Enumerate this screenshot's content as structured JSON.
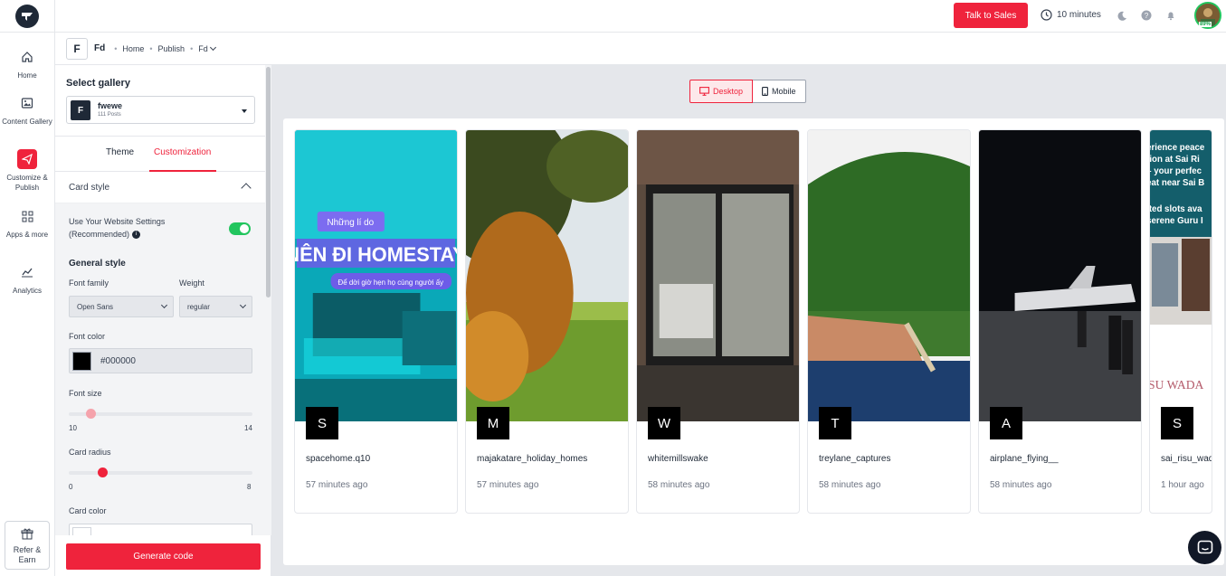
{
  "topbar": {
    "talk_label": "Talk to Sales",
    "timer_label": "10 minutes",
    "avatar_percent": "89%"
  },
  "rail": {
    "items": [
      {
        "label": "Home",
        "icon": "home-icon"
      },
      {
        "label": "Content Gallery",
        "icon": "image-icon"
      },
      {
        "label": "Customize & Publish",
        "icon": "send-icon"
      },
      {
        "label": "Apps & more",
        "icon": "grid-icon"
      },
      {
        "label": "Analytics",
        "icon": "chart-icon"
      }
    ],
    "refer_label": "Refer & Earn"
  },
  "breadcrumb": {
    "badge": "F",
    "name": "Fd",
    "items": [
      "Home",
      "Publish",
      "Fd"
    ]
  },
  "panel": {
    "select_gallery_title": "Select gallery",
    "gallery": {
      "badge": "F",
      "name": "fwewe",
      "posts": "111 Posts"
    },
    "tabs": [
      "Theme",
      "Customization"
    ],
    "active_tab": "Customization",
    "card_style_title": "Card style",
    "website_settings_label": "Use Your Website Settings (Recommended)",
    "website_settings_on": true,
    "general_style_title": "General style",
    "font_family_label": "Font family",
    "font_family_value": "Open Sans",
    "weight_label": "Weight",
    "weight_value": "regular",
    "font_color_label": "Font color",
    "font_color_value": "#000000",
    "font_size_label": "Font size",
    "font_size_min": "10",
    "font_size_max": "14",
    "font_size_level": 0.12,
    "card_radius_label": "Card radius",
    "card_radius_min": "0",
    "card_radius_max": "8",
    "card_radius_level": 0.18,
    "card_color_label": "Card color",
    "generate_label": "Generate code"
  },
  "preview": {
    "desktop_label": "Desktop",
    "mobile_label": "Mobile",
    "active_device": "Desktop",
    "cards": [
      {
        "initial": "S",
        "user": "spacehome.q10",
        "time": "57 minutes ago"
      },
      {
        "initial": "M",
        "user": "majakatare_holiday_homes",
        "time": "57 minutes ago"
      },
      {
        "initial": "W",
        "user": "whitemillswake",
        "time": "58 minutes ago"
      },
      {
        "initial": "T",
        "user": "treylane_captures",
        "time": "58 minutes ago"
      },
      {
        "initial": "A",
        "user": "airplane_flying__",
        "time": "58 minutes ago"
      },
      {
        "initial": "S",
        "user": "sai_risu_wad",
        "time": "1 hour ago"
      }
    ],
    "card1_overlay": [
      "Những lí do",
      "NÊN ĐI HOMESTAY",
      "Để dời giờ hẹn họ cùng người ấy"
    ],
    "card6_overlay": [
      "erience peace",
      "tion at Sai Ri",
      "– your perfec",
      "eat near Sai B",
      "ited slots ava",
      "serene Guru I",
      "SU WADA"
    ]
  },
  "colors": {
    "accent": "#ef233c",
    "toggle_on": "#22c55e",
    "dark": "#1f2937"
  }
}
